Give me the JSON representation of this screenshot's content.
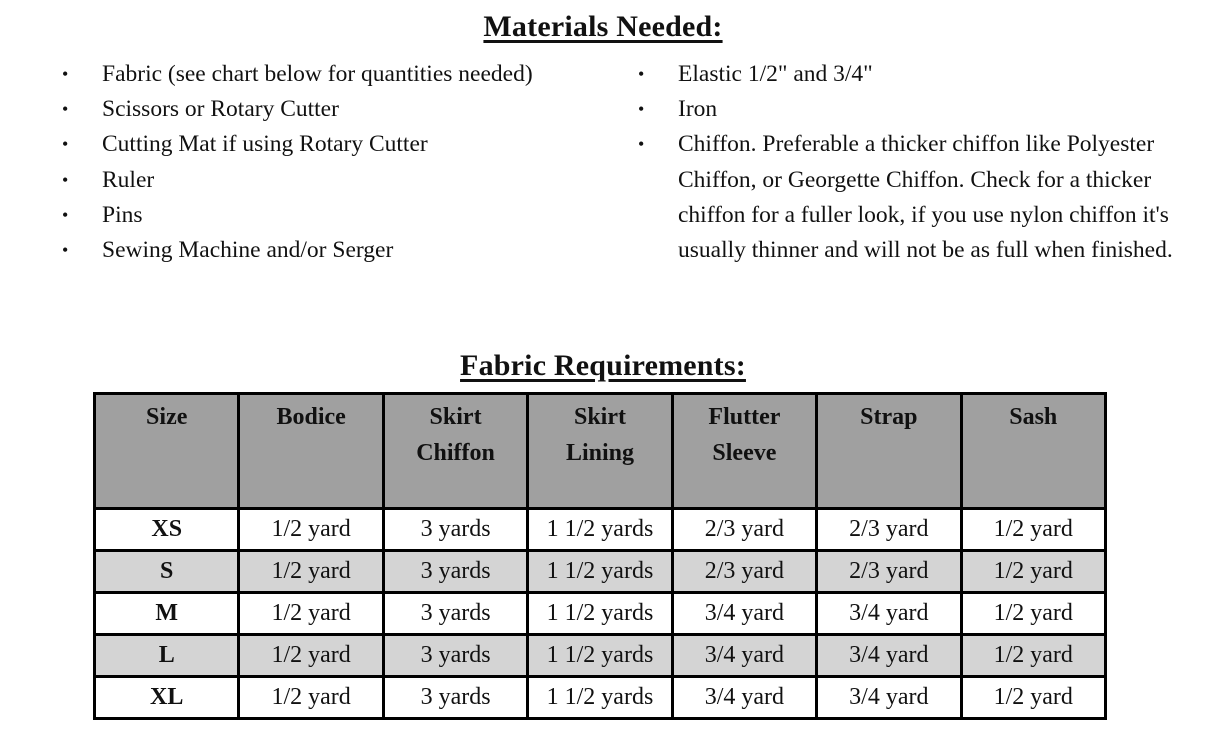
{
  "materials": {
    "title": "Materials Needed:",
    "bullet": "•",
    "left_items": [
      "Fabric (see chart below for quantities needed)",
      "Scissors or Rotary Cutter",
      "Cutting Mat if using Rotary Cutter",
      "Ruler",
      "Pins",
      "Sewing Machine and/or Serger"
    ],
    "right_items": [
      "Elastic 1/2\" and 3/4\"",
      "Iron",
      "Chiffon. Preferable a thicker chiffon like Polyester Chiffon, or Georgette Chiffon. Check for a thicker chiffon for a fuller look, if you use nylon chiffon it's usually thinner and will not be as full when finished."
    ]
  },
  "fabric": {
    "title": "Fabric Requirements:",
    "colors": {
      "header_bg": "#a0a0a0",
      "shaded_row_bg": "#d4d4d4",
      "border": "#000000"
    },
    "headers": [
      [
        "Size"
      ],
      [
        "Bodice"
      ],
      [
        "Skirt",
        "Chiffon"
      ],
      [
        "Skirt",
        "Lining"
      ],
      [
        "Flutter",
        "Sleeve"
      ],
      [
        "Strap"
      ],
      [
        "Sash"
      ]
    ],
    "rows": [
      [
        "XS",
        "1/2 yard",
        "3 yards",
        "1 1/2 yards",
        "2/3 yard",
        "2/3 yard",
        "1/2 yard"
      ],
      [
        "S",
        "1/2 yard",
        "3  yards",
        "1 1/2 yards",
        "2/3 yard",
        "2/3 yard",
        "1/2 yard"
      ],
      [
        "M",
        "1/2 yard",
        "3  yards",
        "1 1/2 yards",
        "3/4 yard",
        "3/4 yard",
        "1/2 yard"
      ],
      [
        "L",
        "1/2 yard",
        "3  yards",
        "1 1/2 yards",
        "3/4 yard",
        "3/4 yard",
        "1/2 yard"
      ],
      [
        "XL",
        "1/2 yard",
        "3  yards",
        "1 1/2 yards",
        "3/4 yard",
        "3/4 yard",
        "1/2 yard"
      ]
    ]
  }
}
